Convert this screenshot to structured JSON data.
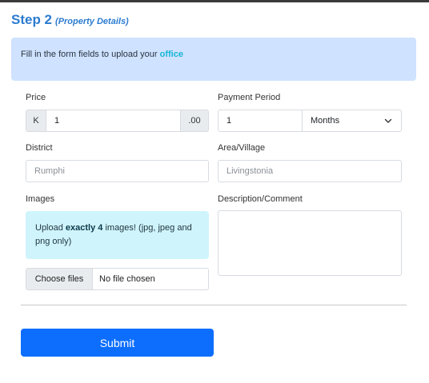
{
  "step": {
    "title": "Step 2",
    "subtitle": "(Property Details)"
  },
  "banner": {
    "text": "Fill in the form fields to upload your ",
    "highlight": "office"
  },
  "price": {
    "label": "Price",
    "prefix": "K",
    "value": "1",
    "suffix": ".00"
  },
  "payment_period": {
    "label": "Payment Period",
    "value": "1",
    "unit": "Months"
  },
  "district": {
    "label": "District",
    "placeholder": "Rumphi"
  },
  "area": {
    "label": "Area/Village",
    "placeholder": "Livingstonia"
  },
  "images": {
    "label": "Images",
    "alert_prefix": "Upload ",
    "alert_bold": "exactly 4",
    "alert_suffix": " images! (jpg, jpeg and png only)",
    "choose_button": "Choose files",
    "status": "No file chosen"
  },
  "description": {
    "label": "Description/Comment"
  },
  "submit": {
    "label": "Submit"
  },
  "colors": {
    "primary": "#0d6efd",
    "heading": "#2b7bd0",
    "banner_bg": "#cfe2ff",
    "upload_alert_bg": "#cff4fc",
    "highlight": "#17b5d6"
  },
  "icons": {
    "select_arrow": "chevron-down-icon"
  }
}
